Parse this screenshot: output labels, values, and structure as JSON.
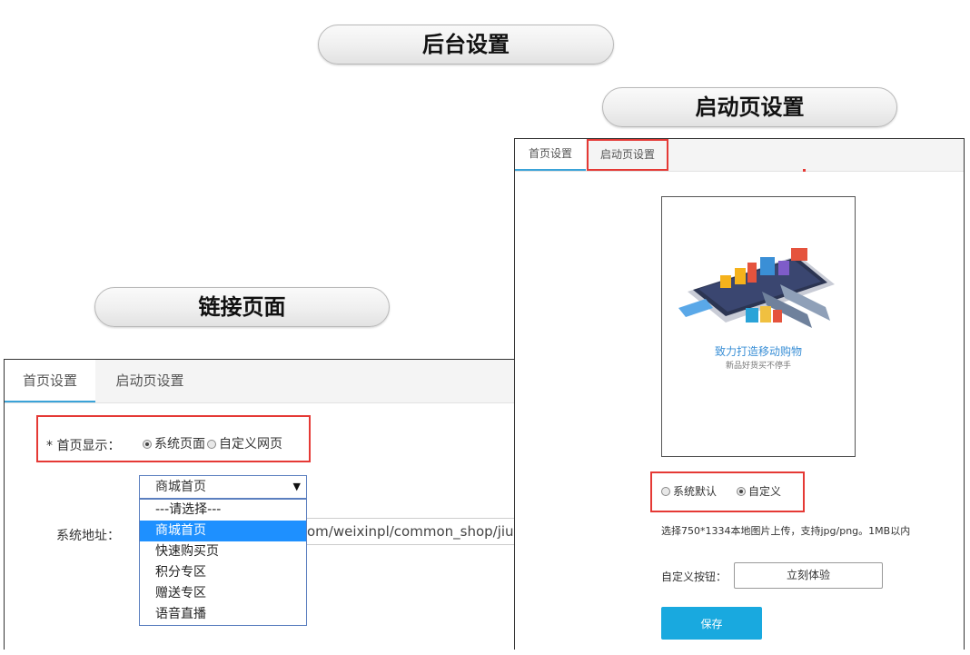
{
  "pills": {
    "backend_settings": "后台设置",
    "splash_settings": "启动页设置",
    "link_page": "链接页面"
  },
  "left_panel": {
    "tabs": [
      "首页设置",
      "启动页设置"
    ],
    "home_display_label": "* 首页显示：",
    "home_display_options": [
      "系统页面",
      "自定义网页"
    ],
    "home_display_selected": "系统页面",
    "select_value": "商城首页",
    "dropdown_options": [
      "---请选择---",
      "商城首页",
      "快速购买页",
      "积分专区",
      "赠送专区",
      "语音直播"
    ],
    "dropdown_highlighted": "商城首页",
    "system_address_label": "系统地址：",
    "system_address_value": "om/weixinpl/common_shop/jiushop"
  },
  "right_panel": {
    "tabs": [
      "首页设置",
      "启动页设置"
    ],
    "preview_slogan": "致力打造移动购物",
    "preview_subslogan": "新品好货买不停手",
    "splash_options": [
      "系统默认",
      "自定义"
    ],
    "splash_selected": "自定义",
    "upload_hint": "选择750*1334本地图片上传，支持jpg/png。1MB以内",
    "custom_button_label": "自定义按钮：",
    "custom_button_value": "立刻体验",
    "save_label": "保存"
  },
  "colors": {
    "highlight_red": "#e53935",
    "accent_blue": "#19a9df",
    "tab_underline": "#3aa3d8",
    "dropdown_selected": "#1e90ff"
  }
}
